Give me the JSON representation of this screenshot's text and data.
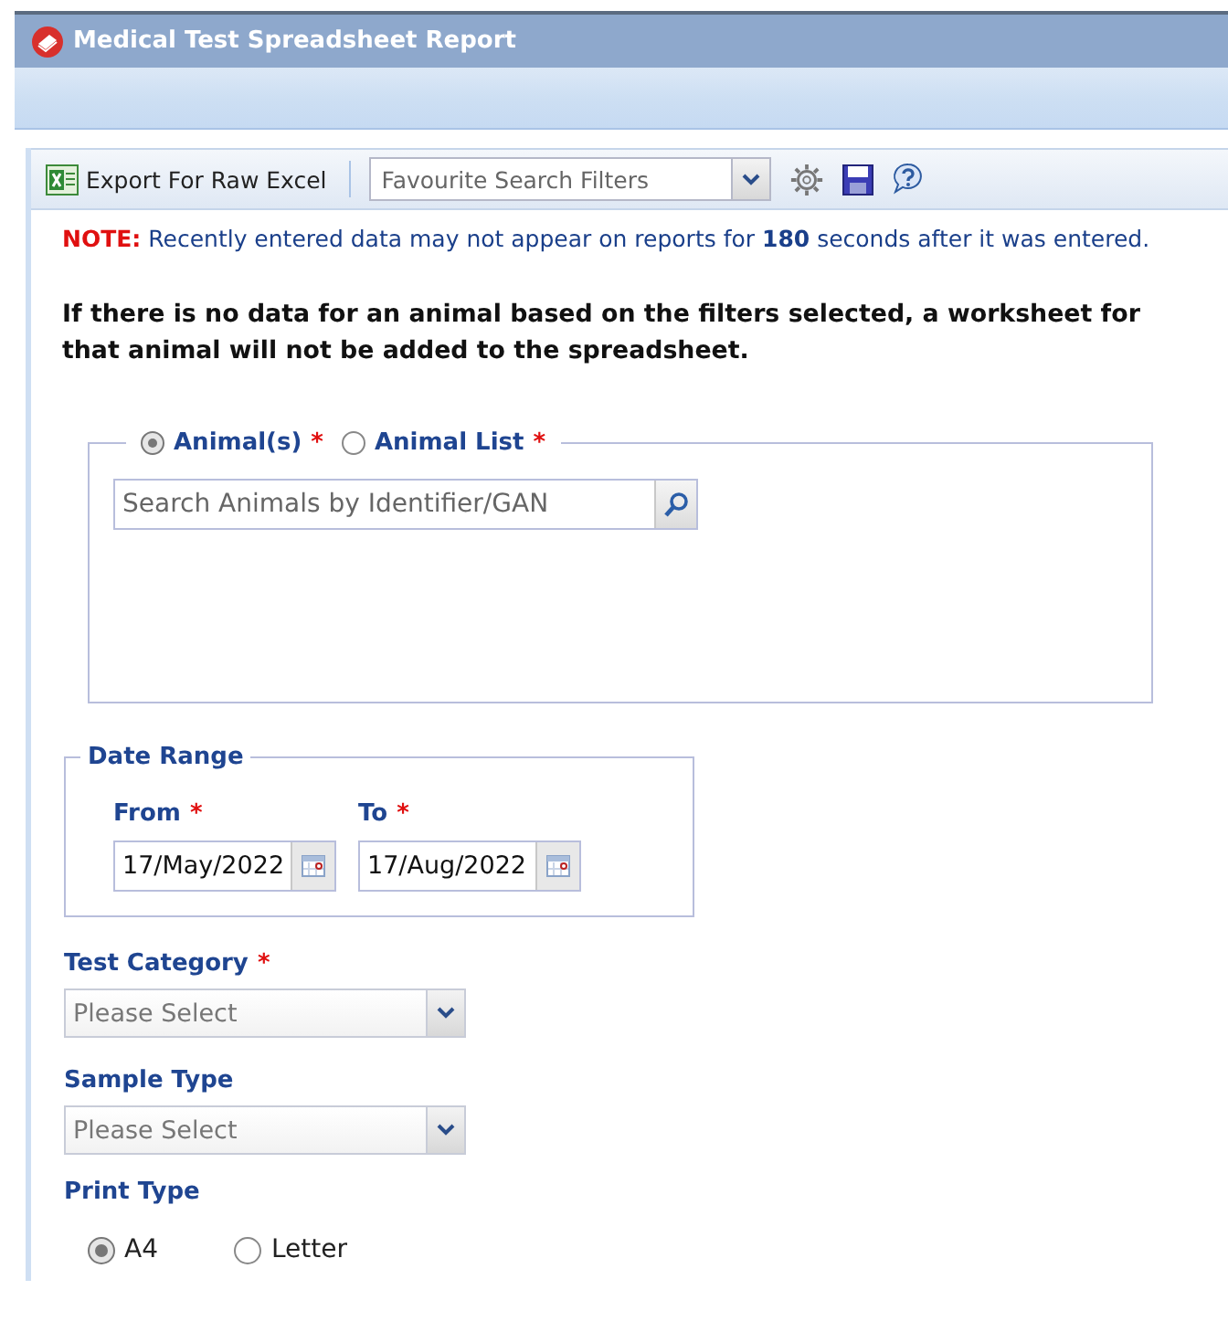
{
  "window": {
    "title": "Medical Test Spreadsheet Report"
  },
  "toolbar": {
    "export_label": "Export For Raw Excel",
    "favourites": {
      "placeholder": "Favourite Search Filters"
    }
  },
  "note": {
    "prefix": "NOTE:",
    "text": "Recently entered data may not appear on reports for **180** seconds after it was entered."
  },
  "info": "If there is no data for an animal based on the filters selected, a worksheet for that animal will not be added to the spreadsheet.",
  "animal_source": {
    "options": [
      {
        "label": "Animal(s)",
        "required_mark": "*",
        "selected": true
      },
      {
        "label": "Animal List",
        "required_mark": "*",
        "selected": false
      }
    ],
    "search": {
      "placeholder": "Search Animals by Identifier/GAN"
    }
  },
  "date_range": {
    "legend": "Date Range",
    "fields": [
      {
        "label": "From",
        "required_mark": "*",
        "value": "17/May/2022"
      },
      {
        "label": "To",
        "required_mark": "*",
        "value": "17/Aug/2022"
      }
    ]
  },
  "selects": [
    {
      "label": "Test Category",
      "required_mark": "*",
      "placeholder": "Please Select"
    },
    {
      "label": "Sample Type",
      "placeholder": "Please Select"
    }
  ],
  "print_type": {
    "label": "Print Type",
    "options": [
      {
        "label": "A4",
        "selected": true
      },
      {
        "label": "Letter",
        "selected": false
      }
    ]
  }
}
